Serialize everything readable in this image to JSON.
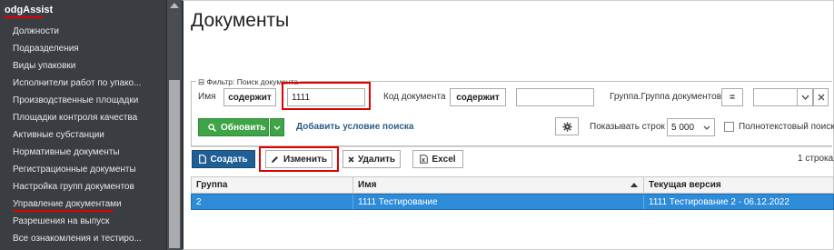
{
  "sidebar": {
    "app_title": "odgAssist",
    "items": [
      {
        "label": "Должности"
      },
      {
        "label": "Подразделения"
      },
      {
        "label": "Виды упаковки"
      },
      {
        "label": "Исполнители работ по упако..."
      },
      {
        "label": "Производственные площадки"
      },
      {
        "label": "Площадки контроля качества"
      },
      {
        "label": "Активные субстанции"
      },
      {
        "label": "Нормативные документы"
      },
      {
        "label": "Регистрационные документы"
      },
      {
        "label": "Настройка групп документов"
      },
      {
        "label": "Управление документами"
      },
      {
        "label": "Разрешения на выпуск"
      },
      {
        "label": "Все ознакомления и тестиро..."
      }
    ]
  },
  "page": {
    "title": "Документы"
  },
  "filter": {
    "legend": "⊟ Фильтр: Поиск документа",
    "name_label": "Имя",
    "name_operator": "содержит",
    "name_value": "1111",
    "code_label": "Код документа",
    "code_operator": "содержит",
    "code_value": "",
    "group_label": "Группа.Группа документов",
    "group_operator": "=",
    "group_value": "",
    "refresh_label": "Обновить",
    "add_condition_label": "Добавить условие поиска",
    "show_rows_label": "Показывать строк",
    "show_rows_value": "5 000",
    "fulltext_label": "Полнотекстовый поиск"
  },
  "toolbar": {
    "create_label": "Создать",
    "edit_label": "Изменить",
    "delete_label": "Удалить",
    "excel_label": "Excel",
    "row_count": "1 строка"
  },
  "table": {
    "columns": [
      "Группа",
      "Имя",
      "Текущая версия"
    ],
    "rows": [
      {
        "group": "2",
        "name": "1111 Тестирование",
        "version": "1111 Тестирование 2 - 06.12.2022"
      }
    ]
  },
  "colors": {
    "sidebar_bg": "#3a3d42",
    "highlight_red": "#e00000",
    "refresh_green": "#3fa447",
    "create_blue": "#1f5f96",
    "selected_row_blue": "#2e8bd8",
    "link_blue": "#2a5d86"
  }
}
